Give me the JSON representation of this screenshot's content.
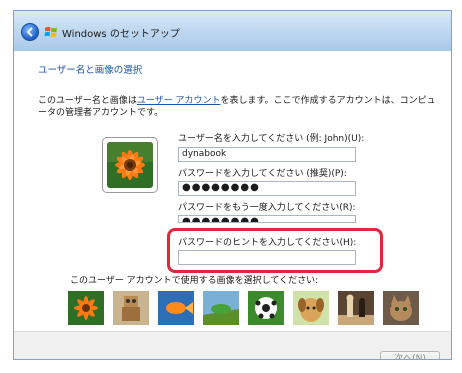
{
  "window": {
    "title": "Windows のセットアップ"
  },
  "content": {
    "heading": "ユーザー名と画像の選択",
    "description_before_link": "このユーザー名と画像は",
    "description_link": "ユーザー アカウント",
    "description_after_link": "を表します。ここで作成するアカウントは、コンピュータの管理者アカウントです。"
  },
  "form": {
    "username_label": "ユーザー名を入力してください (例: John)(U):",
    "username_value": "dynabook",
    "password_label": "パスワードを入力してください (推奨)(P):",
    "password_value": "●●●●●●●●",
    "confirm_label": "パスワードをもう一度入力してください(R):",
    "confirm_value": "●●●●●●●●",
    "hint_label": "パスワードのヒントを入力してください(H):",
    "hint_value": ""
  },
  "pictures": {
    "label": "このユーザー アカウントで使用する画像を選択してください:",
    "items": [
      "flower",
      "robot",
      "goldfish",
      "chameleon",
      "soccer-ball",
      "puppy",
      "chess",
      "kitten"
    ]
  },
  "footer": {
    "next_label": "次へ(N)"
  },
  "colors": {
    "heading": "#1e56a8",
    "callout": "#e3263b"
  }
}
